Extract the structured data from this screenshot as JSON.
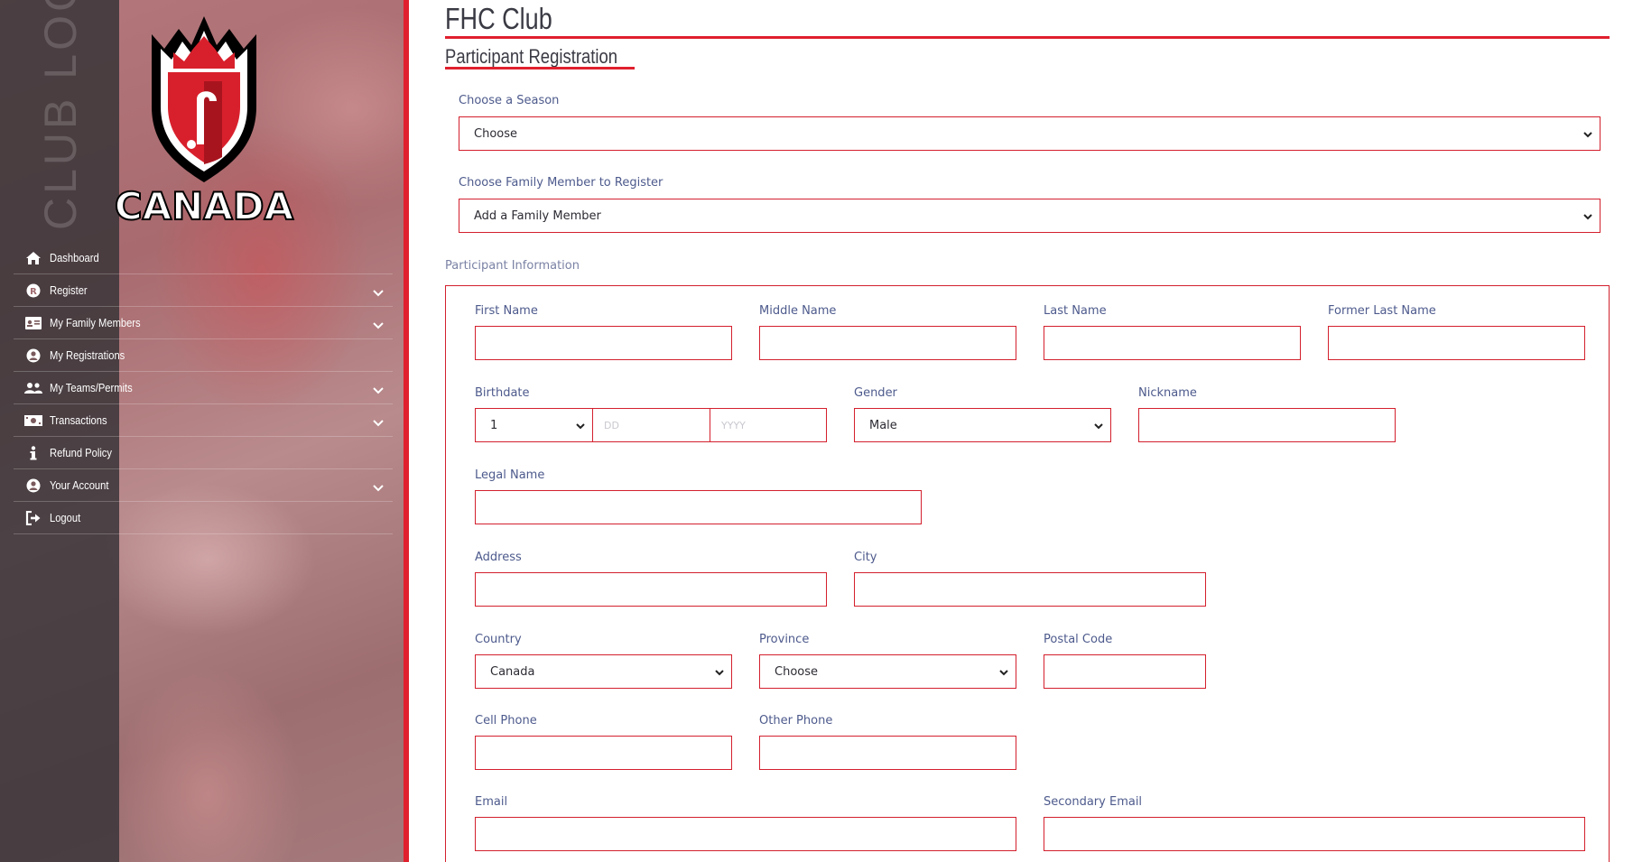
{
  "sidebar": {
    "vertical_title": "CLUB LOGIN",
    "logo_text": "CANADA",
    "nav": [
      {
        "label": "Dashboard",
        "icon": "home-icon",
        "expandable": false
      },
      {
        "label": "Register",
        "icon": "r-circle-icon",
        "expandable": true
      },
      {
        "label": "My Family Members",
        "icon": "id-card-icon",
        "expandable": true
      },
      {
        "label": "My Registrations",
        "icon": "user-circle-icon",
        "expandable": false
      },
      {
        "label": "My Teams/Permits",
        "icon": "users-icon",
        "expandable": true
      },
      {
        "label": "Transactions",
        "icon": "money-icon",
        "expandable": true
      },
      {
        "label": "Refund Policy",
        "icon": "info-icon",
        "expandable": false
      },
      {
        "label": "Your Account",
        "icon": "user-circle-icon",
        "expandable": true
      },
      {
        "label": "Logout",
        "icon": "logout-icon",
        "expandable": false
      }
    ]
  },
  "header": {
    "club_title": "FHC Club",
    "page_title": "Participant Registration"
  },
  "form": {
    "season_label": "Choose a Season",
    "season_value": "Choose",
    "family_label": "Choose Family Member to Register",
    "family_value": "Add a Family Member",
    "section_label": "Participant Information",
    "first_name_label": "First Name",
    "middle_name_label": "Middle Name",
    "last_name_label": "Last Name",
    "former_last_name_label": "Former Last Name",
    "birthdate_label": "Birthdate",
    "birth_month_value": "1",
    "birth_day_placeholder": "DD",
    "birth_year_placeholder": "YYYY",
    "gender_label": "Gender",
    "gender_value": "Male",
    "nickname_label": "Nickname",
    "legal_name_label": "Legal Name",
    "address_label": "Address",
    "city_label": "City",
    "country_label": "Country",
    "country_value": "Canada",
    "province_label": "Province",
    "province_value": "Choose",
    "postal_code_label": "Postal Code",
    "cell_phone_label": "Cell Phone",
    "other_phone_label": "Other Phone",
    "email_label": "Email",
    "secondary_email_label": "Secondary Email"
  },
  "colors": {
    "accent_red": "#e0202e",
    "label_blue": "#4d5a8c",
    "sidebar_dark": "#3c373a"
  }
}
